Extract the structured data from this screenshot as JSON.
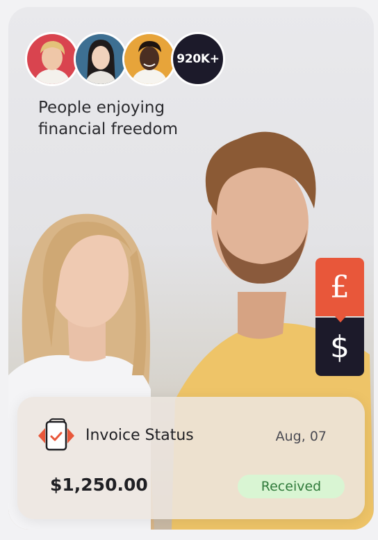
{
  "social_proof": {
    "count_label": "920K+",
    "tagline_line1": "People enjoying",
    "tagline_line2": "financial freedom"
  },
  "currency_tags": {
    "pound_symbol": "£",
    "dollar_symbol": "$"
  },
  "invoice": {
    "title": "Invoice Status",
    "date": "Aug, 07",
    "amount": "$1,250.00",
    "status": "Received"
  },
  "colors": {
    "accent_orange": "#e8573a",
    "dark_navy": "#1c1a2a",
    "status_green_bg": "#d9f5d3",
    "status_green_text": "#2f7a3a"
  }
}
